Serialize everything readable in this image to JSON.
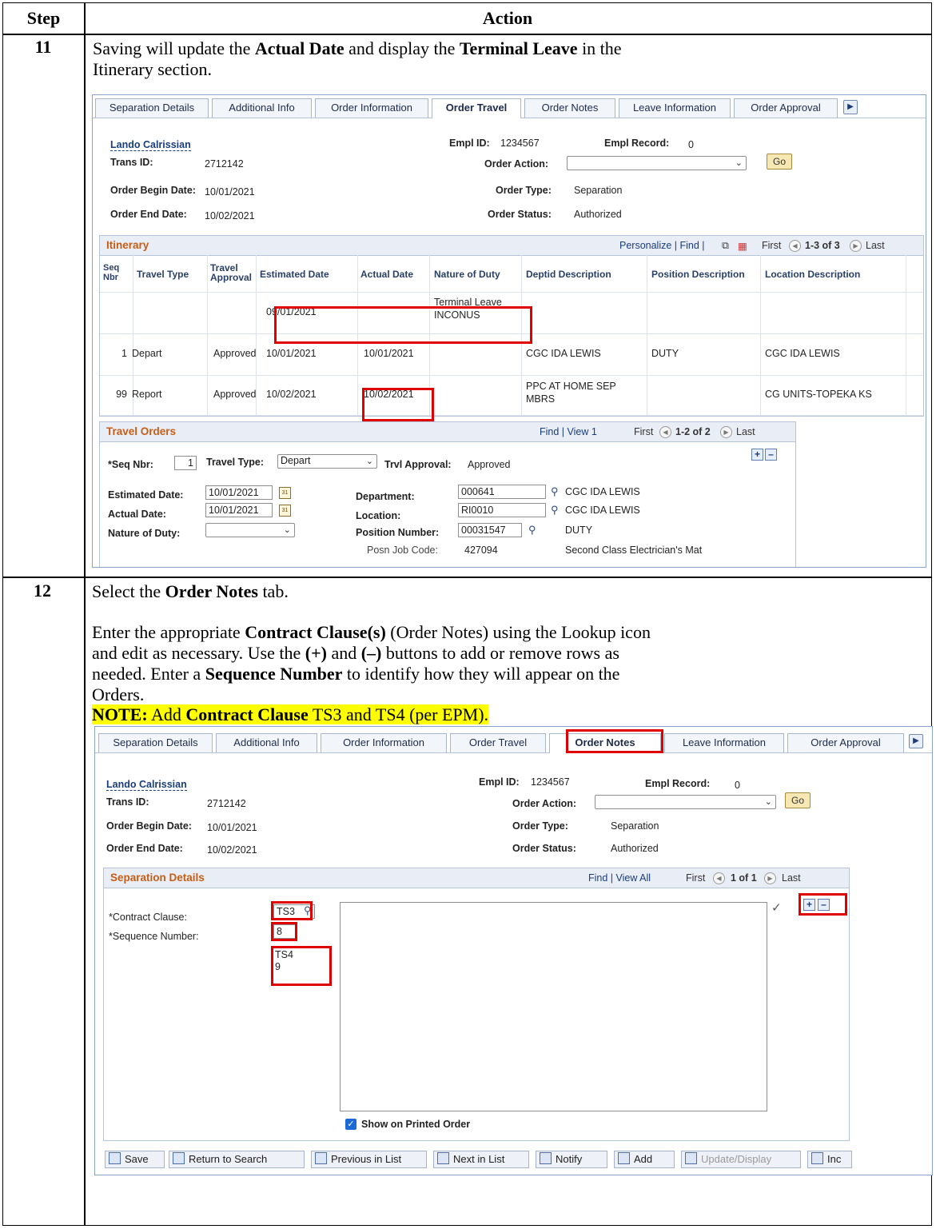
{
  "header": {
    "step": "Step",
    "action": "Action"
  },
  "step11": {
    "num": "11",
    "text_a": "Saving will update the ",
    "text_b": "Actual Date",
    "text_c": " and display the ",
    "text_d": "Terminal Leave",
    "text_e": " in the",
    "text_f": "Itinerary section."
  },
  "step12": {
    "num": "12",
    "line1_a": "Select the ",
    "line1_b": "Order Notes",
    "line1_c": " tab.",
    "p2_l1a": "Enter the appropriate ",
    "p2_l1b": "Contract Clause(s)",
    "p2_l1c": " (Order Notes) using the Lookup icon",
    "p2_l2a": "and edit as necessary.  Use the ",
    "p2_l2b": "(+)",
    "p2_l2c": " and ",
    "p2_l2d": "(–)",
    "p2_l2e": " buttons to add or remove rows as",
    "p2_l3a": "needed.  Enter a ",
    "p2_l3b": "Sequence Number",
    "p2_l3c": " to identify how they will appear on the",
    "p2_l4": "Orders.",
    "note_a": "NOTE:",
    "note_b": " Add ",
    "note_c": "Contract Clause",
    "note_d": " TS3 and TS4 (per EPM)."
  },
  "tabs": [
    "Separation Details",
    "Additional Info",
    "Order Information",
    "Order Travel",
    "Order Notes",
    "Leave Information",
    "Order Approval"
  ],
  "employee": {
    "name": "Lando Calrissian",
    "empl_id_label": "Empl ID:",
    "empl_id": "1234567",
    "empl_record_label": "Empl Record:",
    "empl_record": "0",
    "trans_id_label": "Trans ID:",
    "trans_id": "2712142",
    "order_action_label": "Order Action:",
    "go": "Go",
    "begin_label": "Order Begin Date:",
    "begin": "10/01/2021",
    "type_label": "Order Type:",
    "type": "Separation",
    "end_label": "Order End Date:",
    "end": "10/02/2021",
    "status_label": "Order Status:",
    "status": "Authorized"
  },
  "itinerary": {
    "title": "Itinerary",
    "nav": "Personalize | Find |",
    "first": "First",
    "count": "1-3 of 3",
    "last": "Last",
    "cols": [
      "Seq Nbr",
      "Travel Type",
      "Travel Approval",
      "Estimated Date",
      "Actual Date",
      "Nature of Duty",
      "Deptid Description",
      "Position Description",
      "Location Description"
    ],
    "rows": [
      {
        "seq": "",
        "type": "",
        "appr": "",
        "est": "09/01/2021",
        "act": "",
        "nature1": "Terminal Leave",
        "nature2": "INCONUS",
        "dept": "",
        "pos": "",
        "loc": ""
      },
      {
        "seq": "1",
        "type": "Depart",
        "appr": "Approved",
        "est": "10/01/2021",
        "act": "10/01/2021",
        "nature1": "",
        "nature2": "",
        "dept": "CGC IDA LEWIS",
        "pos": "DUTY",
        "loc": "CGC IDA LEWIS"
      },
      {
        "seq": "99",
        "type": "Report",
        "appr": "Approved",
        "est": "10/02/2021",
        "act": "10/02/2021",
        "nature1": "PPC AT HOME SEP",
        "nature2": "MBRS",
        "dept": "",
        "pos": "",
        "loc": "CG UNITS-TOPEKA KS"
      }
    ]
  },
  "travel_orders": {
    "title": "Travel Orders",
    "nav": "Find | View 1",
    "first": "First",
    "count": "1-2 of 2",
    "last": "Last",
    "seq_label": "*Seq Nbr:",
    "seq": "1",
    "type_label": "Travel Type:",
    "type": "Depart",
    "appr_label": "Trvl Approval:",
    "appr": "Approved",
    "est_label": "Estimated Date:",
    "est": "10/01/2021",
    "act_label": "Actual Date:",
    "act": "10/01/2021",
    "nature_label": "Nature of Duty:",
    "dept_label": "Department:",
    "dept": "000641",
    "dept_desc": "CGC IDA LEWIS",
    "loc_label": "Location:",
    "loc": "RI0010",
    "loc_desc": "CGC IDA LEWIS",
    "pos_label": "Position Number:",
    "pos": "00031547",
    "pos_desc": "DUTY",
    "job_label": "Posn Job Code:",
    "job": "427094",
    "job_desc": "Second Class Electrician's Mat"
  },
  "separation": {
    "title": "Separation Details",
    "nav": "Find | View All",
    "first": "First",
    "count": "1 of 1",
    "last": "Last",
    "clause_label": "*Contract Clause:",
    "clause": "TS3",
    "seq_label": "*Sequence Number:",
    "seq": "8",
    "extra1": "TS4",
    "extra2": "9",
    "show_printed": "Show on Printed Order"
  },
  "toolbar": [
    "Save",
    "Return to Search",
    "Previous in List",
    "Next in List",
    "Notify",
    "Add",
    "Update/Display",
    "Inc"
  ],
  "colors": {
    "highlight": "#e00000",
    "note_bg": "#ffff00",
    "section_title": "#c65d15"
  }
}
